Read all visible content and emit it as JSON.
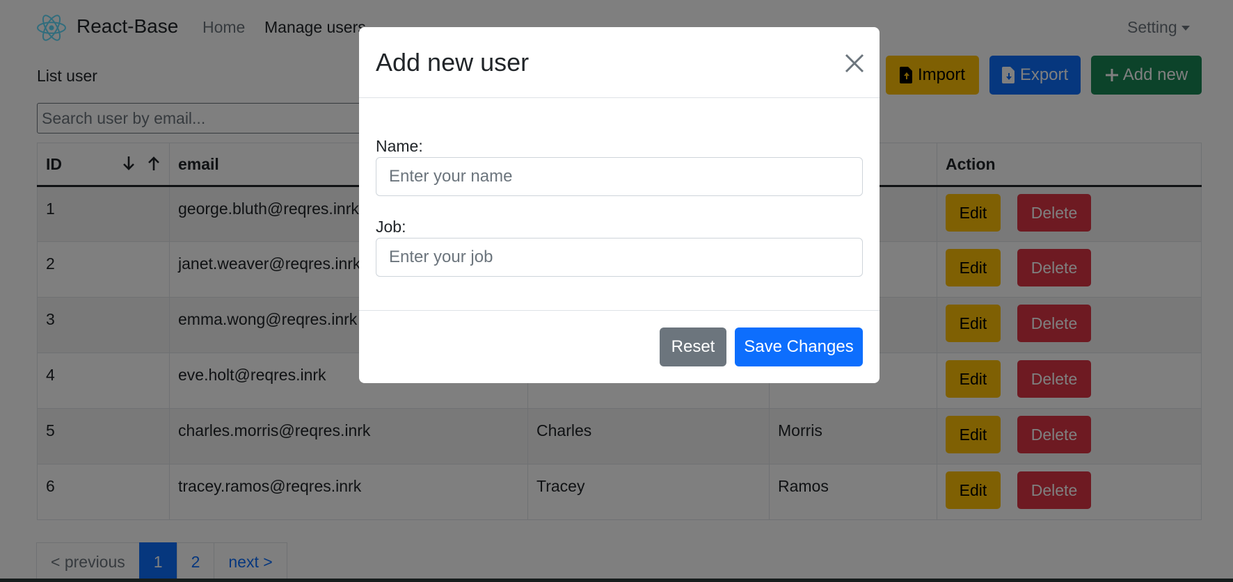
{
  "navbar": {
    "brand": "React-Base",
    "links": [
      {
        "label": "Home",
        "active": false
      },
      {
        "label": "Manage users",
        "active": true
      }
    ],
    "setting": "Setting"
  },
  "toolbar": {
    "title": "List user",
    "import_label": "Import",
    "export_label": "Export",
    "add_label": "Add new"
  },
  "search": {
    "placeholder": "Search user by email...",
    "value": ""
  },
  "table": {
    "headers": {
      "id": "ID",
      "email": "email",
      "action": "Action"
    },
    "rows": [
      {
        "id": "1",
        "email": "george.bluth@reqres.inrk",
        "first_name": "",
        "last_name": ""
      },
      {
        "id": "2",
        "email": "janet.weaver@reqres.inrk",
        "first_name": "",
        "last_name": ""
      },
      {
        "id": "3",
        "email": "emma.wong@reqres.inrk",
        "first_name": "",
        "last_name": ""
      },
      {
        "id": "4",
        "email": "eve.holt@reqres.inrk",
        "first_name": "",
        "last_name": ""
      },
      {
        "id": "5",
        "email": "charles.morris@reqres.inrk",
        "first_name": "Charles",
        "last_name": "Morris"
      },
      {
        "id": "6",
        "email": "tracey.ramos@reqres.inrk",
        "first_name": "Tracey",
        "last_name": "Ramos"
      }
    ],
    "edit_label": "Edit",
    "delete_label": "Delete"
  },
  "pagination": {
    "previous": "< previous",
    "pages": [
      "1",
      "2"
    ],
    "current": "1",
    "next": "next >"
  },
  "modal": {
    "title": "Add new user",
    "name_label": "Name:",
    "name_placeholder": "Enter your name",
    "name_value": "",
    "job_label": "Job:",
    "job_placeholder": "Enter your job",
    "job_value": "",
    "reset_label": "Reset",
    "save_label": "Save Changes"
  },
  "colors": {
    "primary": "#0d6efd",
    "warning": "#ffc107",
    "success": "#198754",
    "danger": "#dc3545",
    "secondary": "#6c757d",
    "react_logo": "#61dafb"
  }
}
